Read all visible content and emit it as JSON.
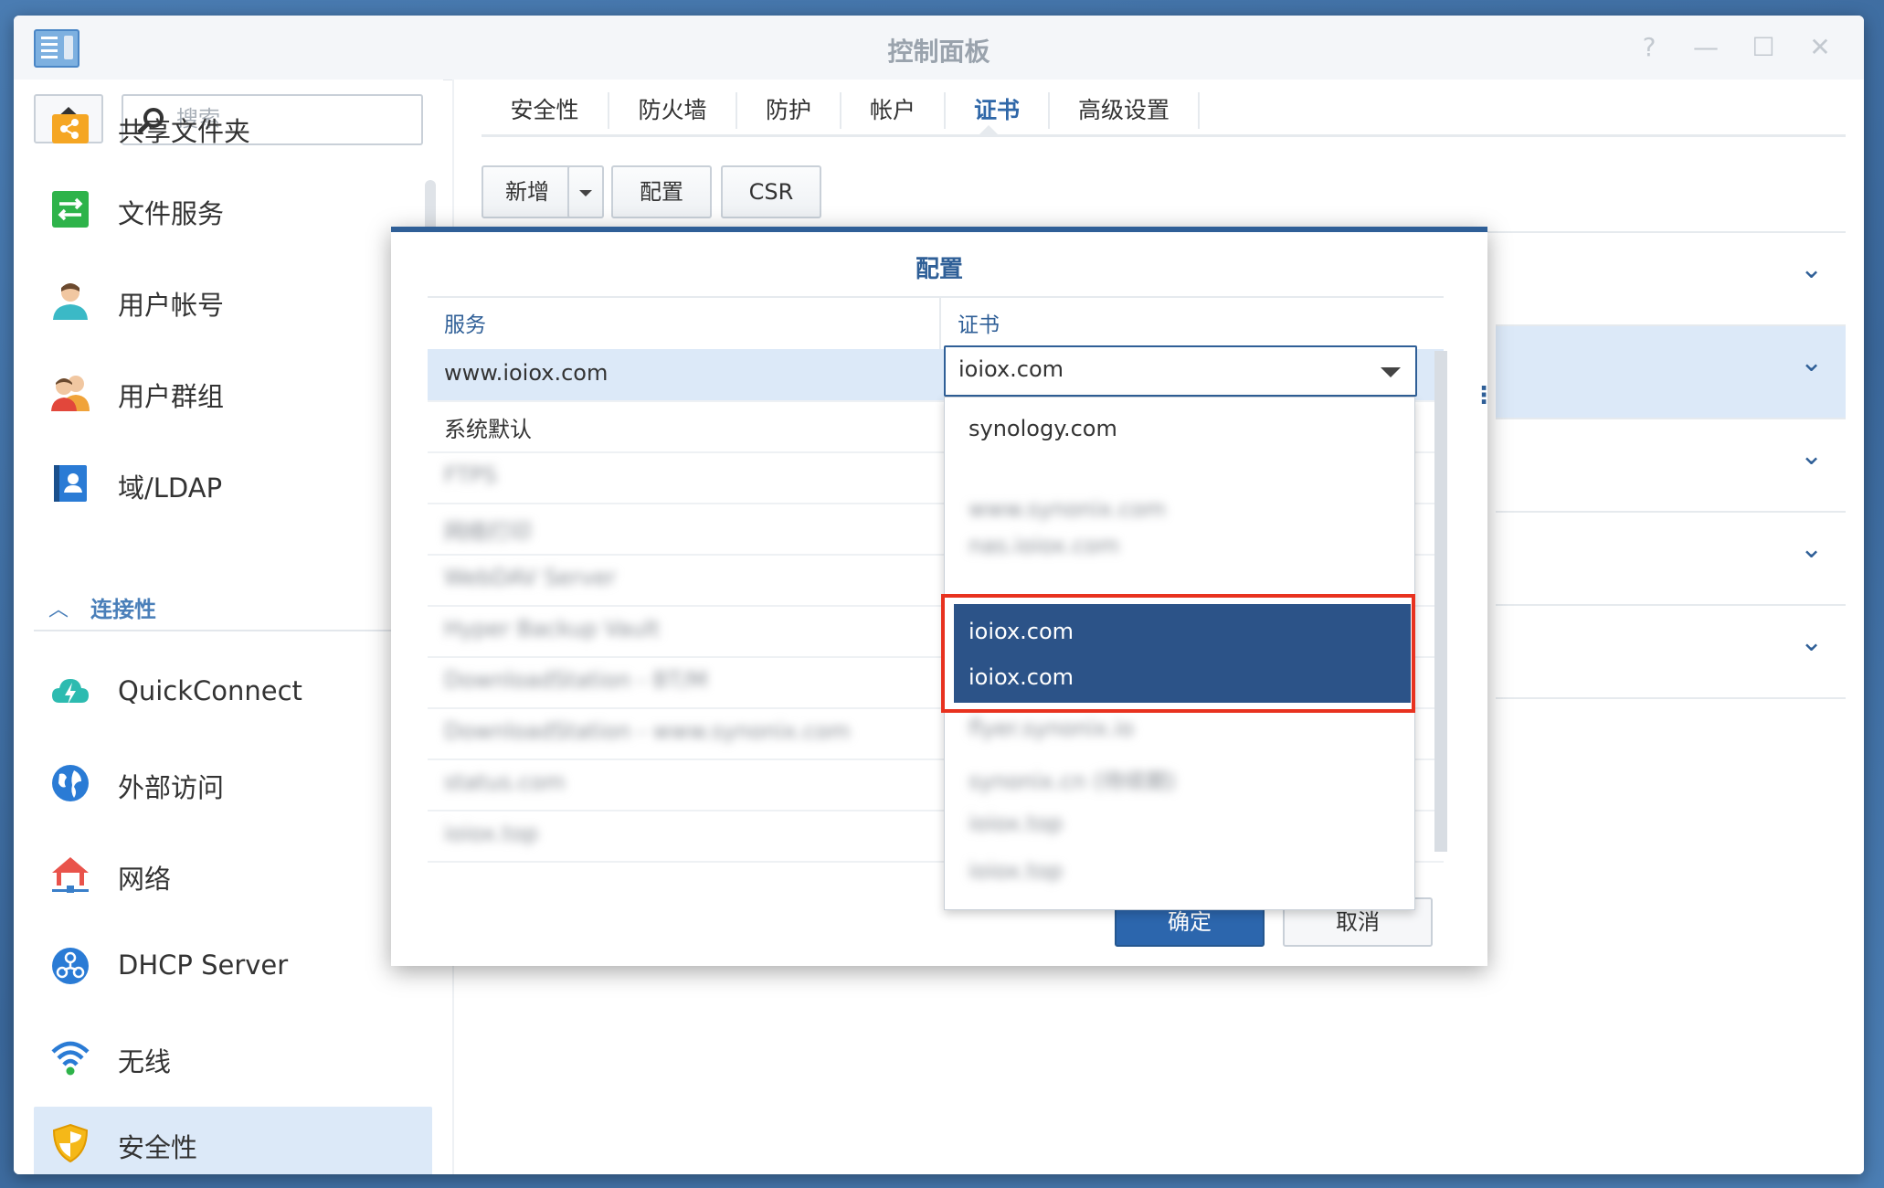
{
  "window": {
    "title": "控制面板",
    "controls": [
      "?",
      "—",
      "☐",
      "✕"
    ]
  },
  "sidebar": {
    "search_placeholder": "搜索",
    "items": [
      {
        "label": "共享文件夹",
        "icon": "shared-folder-icon"
      },
      {
        "label": "文件服务",
        "icon": "file-services-icon"
      },
      {
        "label": "用户帐号",
        "icon": "user-icon"
      },
      {
        "label": "用户群组",
        "icon": "user-group-icon"
      },
      {
        "label": "域/LDAP",
        "icon": "domain-ldap-icon"
      },
      {
        "label": "QuickConnect",
        "icon": "quickconnect-icon"
      },
      {
        "label": "外部访问",
        "icon": "external-access-icon"
      },
      {
        "label": "网络",
        "icon": "network-icon"
      },
      {
        "label": "DHCP Server",
        "icon": "dhcp-server-icon"
      },
      {
        "label": "无线",
        "icon": "wireless-icon"
      },
      {
        "label": "安全性",
        "icon": "security-shield-icon",
        "active": true
      }
    ],
    "section_connectivity": "连接性"
  },
  "tabs": [
    {
      "label": "安全性"
    },
    {
      "label": "防火墙"
    },
    {
      "label": "防护"
    },
    {
      "label": "帐户"
    },
    {
      "label": "证书",
      "active": true
    },
    {
      "label": "高级设置"
    }
  ],
  "toolbar": {
    "add_label": "新增",
    "configure_label": "配置",
    "csr_label": "CSR"
  },
  "modal": {
    "title": "配置",
    "col_service": "服务",
    "col_certificate": "证书",
    "rows": [
      {
        "service": "www.ioiox.com",
        "selected": true
      },
      {
        "service": "系统默认"
      },
      {
        "service": "FTPS",
        "blurred": true
      },
      {
        "service": "网络打印",
        "blurred": true
      },
      {
        "service": "WebDAV Server",
        "blurred": true
      },
      {
        "service": "Hyper Backup Vault",
        "blurred": true
      },
      {
        "service": "DownloadStation - BT/M",
        "blurred": true
      },
      {
        "service": "DownloadStation - www.synonix.com",
        "blurred": true
      },
      {
        "service": "status.com",
        "blurred": true
      },
      {
        "service": "ioiox.top",
        "blurred": true
      }
    ],
    "select_value": "ioiox.com",
    "dropdown_options": [
      {
        "label": "synology.com"
      },
      {
        "label": "www.synonix.com",
        "blurred": true
      },
      {
        "label": "nas.ioiox.com",
        "blurred": true
      },
      {
        "label": "ioiox.com",
        "highlighted": true
      },
      {
        "label": "ioiox.com",
        "highlighted": true
      },
      {
        "label": "flyer.synonix.io",
        "blurred": true
      },
      {
        "label": "synonix.cn (待续期)",
        "blurred": true
      },
      {
        "label": "ioiox.top",
        "blurred": true
      },
      {
        "label": "ioiox.top",
        "blurred": true
      }
    ],
    "ok_label": "确定",
    "cancel_label": "取消"
  },
  "colors": {
    "accent": "#2f5f97",
    "highlight": "#2c5388",
    "annotation_red": "#e8321f",
    "selected_row": "#dce9f8"
  }
}
